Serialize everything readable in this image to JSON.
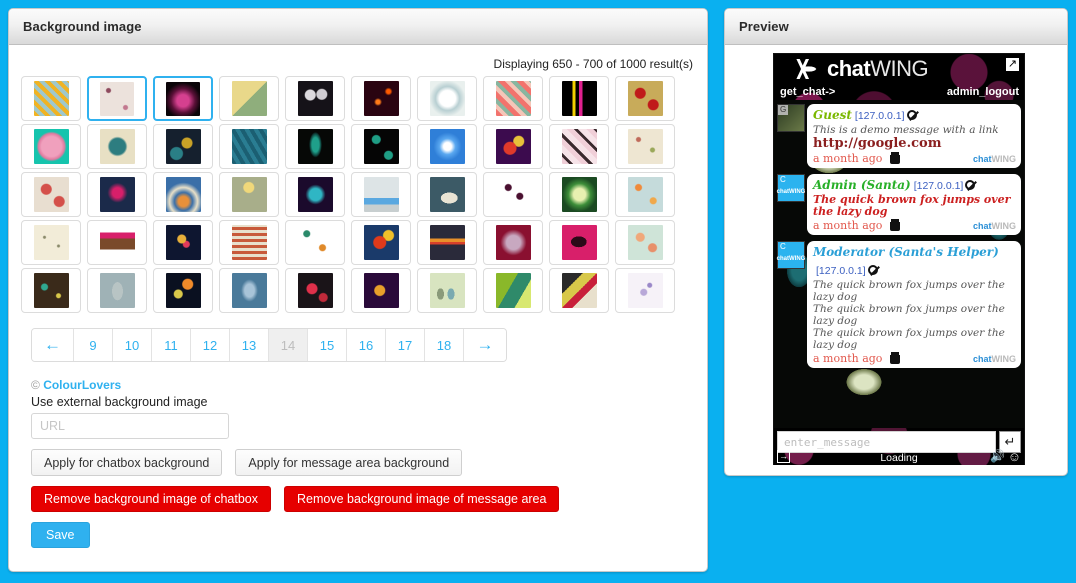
{
  "background_panel": {
    "title": "Background image",
    "results_text": "Displaying 650 - 700 of 1000 result(s)",
    "thumbnails": [
      {
        "id": "t1",
        "name": "yellow-floral-teal",
        "selected": false,
        "css": "repeating-linear-gradient(45deg,#f0b323 0 4px,#9fc8cc 4px 8px),#9fc8cc"
      },
      {
        "id": "t2",
        "name": "mauve-polka-dots",
        "selected": true,
        "css": "radial-gradient(circle at 25% 25%,#8e4a5e 0 2px,transparent 3px),radial-gradient(circle at 75% 75%,#c2788f 0 2px,transparent 3px),#ece2dc"
      },
      {
        "id": "t3",
        "name": "pink-fractal-black",
        "selected": true,
        "css": "radial-gradient(circle at 50% 55%,#d5408f 0 6px,#5b1038 12px,#0a0408 18px),#060208"
      },
      {
        "id": "t4",
        "name": "retro-squares",
        "selected": false,
        "css": "linear-gradient(135deg,#e9d88a 0 50%,#8fae7c 50%),#d9cf9a"
      },
      {
        "id": "t5",
        "name": "white-flowers-dark",
        "selected": false,
        "css": "radial-gradient(circle at 35% 40%,#dcd9de 0 5px,transparent 6px),radial-gradient(circle at 68% 38%,#cfccd2 0 5px,transparent 6px),#151218"
      },
      {
        "id": "t6",
        "name": "orange-sparks-maroon",
        "selected": false,
        "css": "radial-gradient(circle at 40% 60%,#ff7a18 0 2px,transparent 4px),radial-gradient(circle at 70% 30%,#ff5a00 0 2px,transparent 4px),#2a0411"
      },
      {
        "id": "t7",
        "name": "pale-medallion",
        "selected": false,
        "css": "radial-gradient(circle at 50% 50%,#ffffff 0 8px,#b8cfd2 12px,#e9f0ee 18px),#e4ecea"
      },
      {
        "id": "t8",
        "name": "coral-diagonal-stripes",
        "selected": false,
        "css": "repeating-linear-gradient(45deg,#f2736d 0 5px,#f5c6b8 5px 9px,#88b6a0 9px 13px)"
      },
      {
        "id": "t9",
        "name": "neon-pixel-black",
        "selected": false,
        "css": "linear-gradient(90deg,#000 0 30%,#f0d000 30% 38%,#000 38% 48%,#e0208f 48% 58%,#000 58%)"
      },
      {
        "id": "t10",
        "name": "red-circles-gold",
        "selected": false,
        "css": "radial-gradient(circle at 35% 35%,#c01a1a 0 5px,transparent 6px),radial-gradient(circle at 72% 68%,#c01a1a 0 5px,transparent 6px),#c8ab5a"
      },
      {
        "id": "t11",
        "name": "pink-flower-teal",
        "selected": false,
        "css": "radial-gradient(circle at 50% 50%,#f0a0bd 0 10px,#e07ba0 13px,#16c4ad 15px),#16c4ad"
      },
      {
        "id": "t12",
        "name": "teal-mandala-cream",
        "selected": false,
        "css": "radial-gradient(circle at 50% 50%,#2d7d80 0 8px,#e8e0c4 10px),#e8e0c4"
      },
      {
        "id": "t13",
        "name": "gold-swirl-navy",
        "selected": false,
        "css": "radial-gradient(circle at 60% 40%,#c9a227 0 5px,transparent 6px),radial-gradient(circle at 30% 70%,#2a7f86 0 6px,transparent 7px),#15202e"
      },
      {
        "id": "t14",
        "name": "teal-chevron",
        "selected": false,
        "css": "repeating-linear-gradient(60deg,#1b5f72 0 4px,#2a7d92 4px 8px)"
      },
      {
        "id": "t15",
        "name": "peacock-feather-dark",
        "selected": false,
        "css": "radial-gradient(ellipse 8px 16px at 50% 45%,#1fa08a 0 45%,#0d3b36 70%,#060806 80%),#060806"
      },
      {
        "id": "t16",
        "name": "green-crescents-black",
        "selected": false,
        "css": "radial-gradient(circle at 35% 30%,#1f9e85 0 4px,transparent 5px),radial-gradient(circle at 70% 75%,#1f9e85 0 4px,transparent 5px),#050505"
      },
      {
        "id": "t17",
        "name": "blue-kaleidoscope",
        "selected": false,
        "css": "radial-gradient(circle at 50% 50%,#ffffff 0 4px,#5aa8f0 8px,#2f7fd8 14px),#4f9ae8"
      },
      {
        "id": "t18",
        "name": "abstract-circles-purple",
        "selected": false,
        "css": "radial-gradient(circle at 40% 55%,#e03a2a 0 6px,transparent 7px),radial-gradient(circle at 65% 35%,#e8c23a 0 5px,transparent 6px),#3c0b4e"
      },
      {
        "id": "t19",
        "name": "pink-bowtie-pattern",
        "selected": false,
        "css": "repeating-linear-gradient(45deg,#f0cfd8 0 5px,#3a2a2e 5px 8px,#f6e3e8 8px 14px)"
      },
      {
        "id": "t20",
        "name": "butterflies-cream",
        "selected": false,
        "css": "radial-gradient(circle at 30% 30%,#c06a5a 0 2px,transparent 3px),radial-gradient(circle at 70% 60%,#9aa85a 0 2px,transparent 3px),#eee6d2"
      },
      {
        "id": "t21",
        "name": "red-roses-cream",
        "selected": false,
        "css": "radial-gradient(circle at 35% 35%,#d4504a 0 5px,transparent 6px),radial-gradient(circle at 72% 70%,#d4504a 0 5px,transparent 6px),#e8ded0"
      },
      {
        "id": "t22",
        "name": "tribal-magenta-navy",
        "selected": false,
        "css": "radial-gradient(circle at 50% 45%,#d81f6a 0 5px,#1b2a4a 10px),#17233d"
      },
      {
        "id": "t23",
        "name": "concentric-rainbow",
        "selected": false,
        "css": "radial-gradient(circle at 50% 70%,#e8903a 0 5px,#3a6fa8 9px,#e8e0c8 14px,#3a6fa8 19px),#e8e0c8"
      },
      {
        "id": "t24",
        "name": "dandelion-sage",
        "selected": false,
        "css": "radial-gradient(circle at 48% 30%,#f0d87a 0 5px,transparent 6px),#a8ae8a"
      },
      {
        "id": "t25",
        "name": "teal-cross-purple",
        "selected": false,
        "css": "radial-gradient(circle at 50% 50%,#2fb6c4 0 6px,#1b0a2c 10px),#2b0f3e"
      },
      {
        "id": "t26",
        "name": "pixel-ghosts-grey",
        "selected": false,
        "css": "linear-gradient(to bottom,#dde4e6 0 60%,#5aa8e0 60% 78%,#c8cfd0 78%)"
      },
      {
        "id": "t27",
        "name": "whale-teal",
        "selected": false,
        "css": "radial-gradient(ellipse 14px 9px at 55% 60%,#e9e4d4 0 60%,transparent 61%),#3c5a66"
      },
      {
        "id": "t28",
        "name": "berries-white",
        "selected": false,
        "css": "radial-gradient(circle at 35% 30%,#4a1030 0 3px,transparent 4px),radial-gradient(circle at 68% 55%,#4a1030 0 3px,transparent 4px),#ffffff"
      },
      {
        "id": "t29",
        "name": "green-kaleidoscope",
        "selected": false,
        "css": "radial-gradient(circle at 50% 50%,#e8f0b0 0 6px,#3e8f3a 11px,#1b4a22 17px),#2c6b2e"
      },
      {
        "id": "t30",
        "name": "orange-dots-pale-blue",
        "selected": false,
        "css": "radial-gradient(circle at 30% 30%,#f08a3a 0 3px,transparent 4px),radial-gradient(circle at 72% 68%,#f0a84a 0 3px,transparent 4px),#c5dbdb"
      },
      {
        "id": "t31",
        "name": "pale-cream-scatter",
        "selected": false,
        "css": "radial-gradient(circle at 30% 35%,#8a8a6a 0 1px,transparent 2px),radial-gradient(circle at 70% 60%,#8a8a6a 0 1px,transparent 2px),#f2ecd8"
      },
      {
        "id": "t32",
        "name": "chevron-magenta-brown",
        "selected": false,
        "css": "linear-gradient(to bottom,#ffffff 0 22%,#d81f6a 22% 38%,#7a4a2a 38% 70%,#ffffff 70%)"
      },
      {
        "id": "t33",
        "name": "tulip-navy",
        "selected": false,
        "css": "radial-gradient(circle at 45% 40%,#e8b03a 0 4px,transparent 5px),radial-gradient(circle at 58% 55%,#e03a5a 0 3px,transparent 4px),#0e1630"
      },
      {
        "id": "t34",
        "name": "multicolor-checks",
        "selected": false,
        "css": "repeating-linear-gradient(0deg,#c85a3a 0 3px,#e8e0cc 3px 6px),repeating-linear-gradient(90deg,#3a7a8a 0 3px,transparent 3px 6px)"
      },
      {
        "id": "t35",
        "name": "colorful-polka-dots",
        "selected": false,
        "css": "radial-gradient(circle at 25% 25%,#2a8a6a 0 3px,transparent 4px),radial-gradient(circle at 70% 65%,#e08a2a 0 3px,transparent 4px),#ffffff"
      },
      {
        "id": "t36",
        "name": "abstract-red-yellow",
        "selected": false,
        "css": "radial-gradient(circle at 45% 50%,#e03a1a 0 6px,transparent 7px),radial-gradient(circle at 70% 30%,#f0c02a 0 5px,transparent 6px),#1a3a6a"
      },
      {
        "id": "t37",
        "name": "sunset-gradient",
        "selected": false,
        "css": "linear-gradient(to bottom,#2a2a3a 0 38%,#e8902a 38% 48%,#d8402a 48% 56%,#2a2a3a 56%)"
      },
      {
        "id": "t38",
        "name": "maroon-mandala",
        "selected": false,
        "css": "radial-gradient(circle at 50% 50%,#c8a8c0 0 7px,#8a1030 13px),#6a0a24"
      },
      {
        "id": "t39",
        "name": "bird-magenta",
        "selected": false,
        "css": "radial-gradient(ellipse 13px 9px at 48% 48%,#2a0a18 0 60%,transparent 61%),#d81f6a"
      },
      {
        "id": "t40",
        "name": "peach-roses-mint",
        "selected": false,
        "css": "radial-gradient(circle at 35% 35%,#f0a87a 0 4px,transparent 5px),radial-gradient(circle at 70% 65%,#e8906a 0 4px,transparent 5px),#cfe4d8"
      },
      {
        "id": "t41",
        "name": "teal-leaves-brown",
        "selected": false,
        "css": "radial-gradient(circle at 30% 40%,#2fa890 0 3px,transparent 4px),radial-gradient(circle at 70% 65%,#d8c84a 0 2px,transparent 3px),#3a2a1a"
      },
      {
        "id": "t42",
        "name": "owl-grey-blue",
        "selected": false,
        "css": "radial-gradient(ellipse 9px 15px at 50% 52%,#b8c4c4 0 60%,transparent 61%),#9fb2b6"
      },
      {
        "id": "t43",
        "name": "moon-circles-navy",
        "selected": false,
        "css": "radial-gradient(circle at 62% 32%,#f08a2a 0 5px,transparent 6px),radial-gradient(circle at 35% 60%,#d8c84a 0 4px,transparent 5px),#0a1020"
      },
      {
        "id": "t44",
        "name": "blue-damask",
        "selected": false,
        "css": "radial-gradient(ellipse 12px 16px at 50% 50%,#a8c4d8 0 40%,#4a7a9a 70%),#3a6a8a"
      },
      {
        "id": "t45",
        "name": "red-floral-dark",
        "selected": false,
        "css": "radial-gradient(circle at 40% 45%,#e0304a 0 5px,transparent 6px),radial-gradient(circle at 72% 70%,#c02a3a 0 4px,transparent 5px),#1a1418"
      },
      {
        "id": "t46",
        "name": "peacock-gold-purple",
        "selected": false,
        "css": "radial-gradient(circle at 45% 50%,#e8a02a 0 5px,transparent 6px),#2a0a3a"
      },
      {
        "id": "t47",
        "name": "owls-pale-green",
        "selected": false,
        "css": "radial-gradient(ellipse 5px 8px at 30% 60%,#8a9a7a 0 70%,transparent 71%),radial-gradient(ellipse 5px 8px at 60% 60%,#7aaab0 0 70%,transparent 71%),#d8e4c0"
      },
      {
        "id": "t48",
        "name": "green-leaves",
        "selected": false,
        "css": "linear-gradient(120deg,#8ab82a 0 40%,#2f8a6a 40% 70%,#d8e870 70%)"
      },
      {
        "id": "t49",
        "name": "abstract-ribbon",
        "selected": false,
        "css": "linear-gradient(135deg,#2a2a2a 0 30%,#d8c84a 30% 50%,#c81f3a 50% 65%,#e8e0cc 65%)"
      },
      {
        "id": "t50",
        "name": "lavender-branch-white",
        "selected": false,
        "css": "radial-gradient(circle at 45% 55%,#b8a8d8 0 3px,transparent 4px),radial-gradient(circle at 62% 35%,#9a88c8 0 2px,transparent 3px),#f6f2f8"
      }
    ],
    "pagination": {
      "prev_label": "←",
      "next_label": "→",
      "pages": [
        "9",
        "10",
        "11",
        "12",
        "13",
        "14",
        "15",
        "16",
        "17",
        "18"
      ],
      "current": "14"
    },
    "credit": {
      "mark": "©",
      "link_label": "ColourLovers"
    },
    "external_image": {
      "label": "Use external background image",
      "url_placeholder": "URL",
      "url_value": ""
    },
    "buttons": {
      "apply_chatbox": "Apply for chatbox background",
      "apply_message_area": "Apply for message area background",
      "remove_chatbox": "Remove background image of chatbox",
      "remove_message_area": "Remove background image of message area",
      "save": "Save"
    }
  },
  "preview_panel": {
    "title": "Preview",
    "chat": {
      "brand_bold": "chat",
      "brand_light": "WING",
      "get_chat_label": "get_chat->",
      "admin_logout_label": "admin_logout",
      "expand_icon": "↗",
      "messages": [
        {
          "avatar_tag": "G",
          "avatar_kind": "guest",
          "author": "Guest",
          "author_color_class": "n-guest",
          "ip": "[127.0.0.1]",
          "lines": [
            "This is a demo message with a link"
          ],
          "link": "http://google.com",
          "time": "a month ago",
          "brand_c1": "chat",
          "brand_c2": "WING"
        },
        {
          "avatar_tag": "C",
          "avatar_kind": "cw",
          "author": "Admin (Santa)",
          "author_color_class": "n-admin",
          "ip": "[127.0.0.1]",
          "lines_red": [
            "The quick brown fox jumps over the lazy dog"
          ],
          "time": "a month ago",
          "brand_c1": "chat",
          "brand_c2": "WING"
        },
        {
          "avatar_tag": "C",
          "avatar_kind": "cw",
          "author": "Moderator (Santa's Helper)",
          "author_color_class": "n-mod",
          "ip": "[127.0.0.1]",
          "lines": [
            "The quick brown fox jumps over the lazy dog",
            "The quick brown fox jumps over the lazy dog",
            "The quick brown fox jumps over the lazy dog"
          ],
          "time": "a month ago",
          "brand_c1": "chat",
          "brand_c2": "WING"
        }
      ],
      "input_placeholder": "enter_message",
      "input_value": "",
      "send_label": "↵",
      "status": "Loading",
      "login_icon": "→",
      "sound_icon": "🔊",
      "smiley_icon": "☺"
    }
  },
  "colors": {
    "page_background": "#0ab0f0",
    "accent": "#2fb1ef",
    "danger": "#e60000"
  }
}
